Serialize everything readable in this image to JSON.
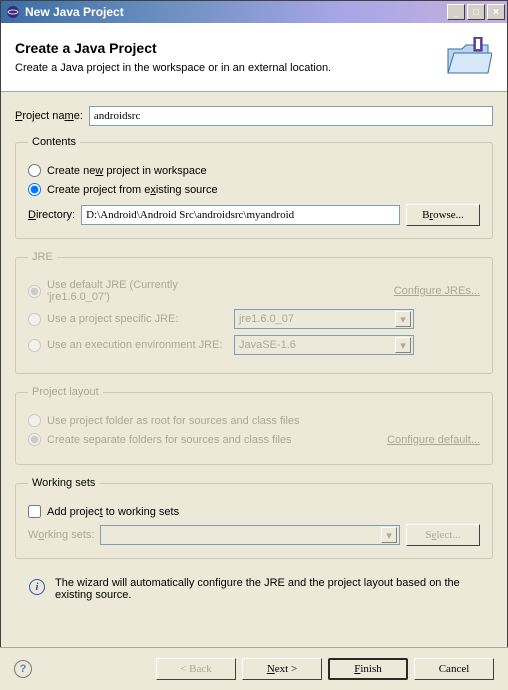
{
  "window": {
    "title": "New Java Project"
  },
  "banner": {
    "heading": "Create a Java Project",
    "subheading": "Create a Java project in the workspace or in an external location."
  },
  "project": {
    "name_label": "Project name:",
    "name_value": "androidsrc"
  },
  "contents": {
    "legend": "Contents",
    "opt_workspace": "Create new project in workspace",
    "opt_existing": "Create project from existing source",
    "directory_label": "Directory:",
    "directory_value": "D:\\Android\\Android Src\\androidsrc\\myandroid",
    "browse": "Browse..."
  },
  "jre": {
    "legend": "JRE",
    "opt_default": "Use default JRE (Currently 'jre1.6.0_07')",
    "opt_specific": "Use a project specific JRE:",
    "opt_env": "Use an execution environment JRE:",
    "specific_value": "jre1.6.0_07",
    "env_value": "JavaSE-1.6",
    "configure": "Configure JREs..."
  },
  "layout": {
    "legend": "Project layout",
    "opt_root": "Use project folder as root for sources and class files",
    "opt_separate": "Create separate folders for sources and class files",
    "configure": "Configure default..."
  },
  "working_sets": {
    "legend": "Working sets",
    "checkbox_label": "Add project to working sets",
    "label": "Working sets:",
    "select_btn": "Select..."
  },
  "info": {
    "message": "The wizard will automatically configure the JRE and the project layout based on the existing source."
  },
  "buttons": {
    "back": "< Back",
    "next": "Next >",
    "finish": "Finish",
    "cancel": "Cancel"
  }
}
